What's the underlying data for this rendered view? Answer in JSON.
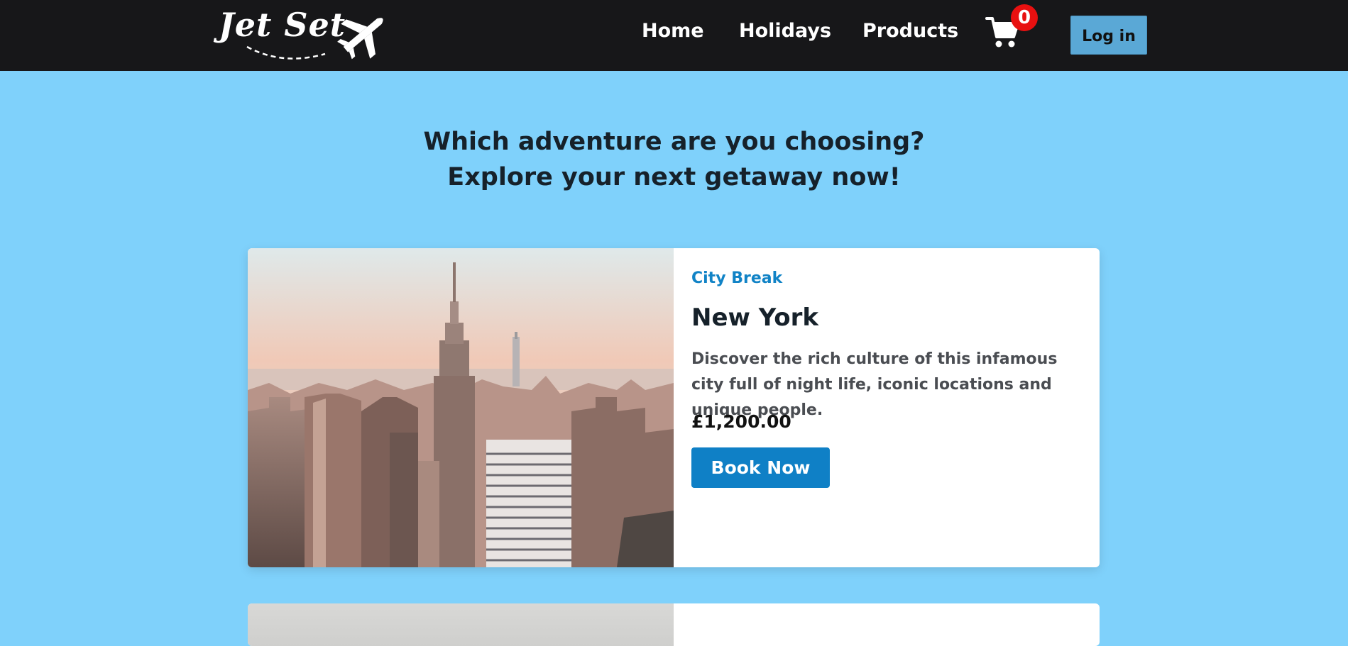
{
  "header": {
    "logo_text": "Jet Set",
    "nav": [
      "Home",
      "Holidays",
      "Products"
    ],
    "cart_icon": "shopping-cart-icon",
    "cart_count": "0",
    "login_label": "Log in"
  },
  "hero": {
    "line1": "Which adventure are you choosing?",
    "line2": "Explore your next getaway now!"
  },
  "cards": [
    {
      "category": "City Break",
      "title": "New York",
      "description": "Discover the rich culture of this infamous city full of night life, iconic locations and unique people.",
      "price": "£1,200.00",
      "button": "Book Now",
      "image": "new-york-skyline-photo"
    }
  ],
  "colors": {
    "header_bg": "#171719",
    "page_bg": "#7fd1fb",
    "accent": "#0f80c6",
    "badge": "#e81010",
    "login_bg": "#5aa8d6"
  }
}
